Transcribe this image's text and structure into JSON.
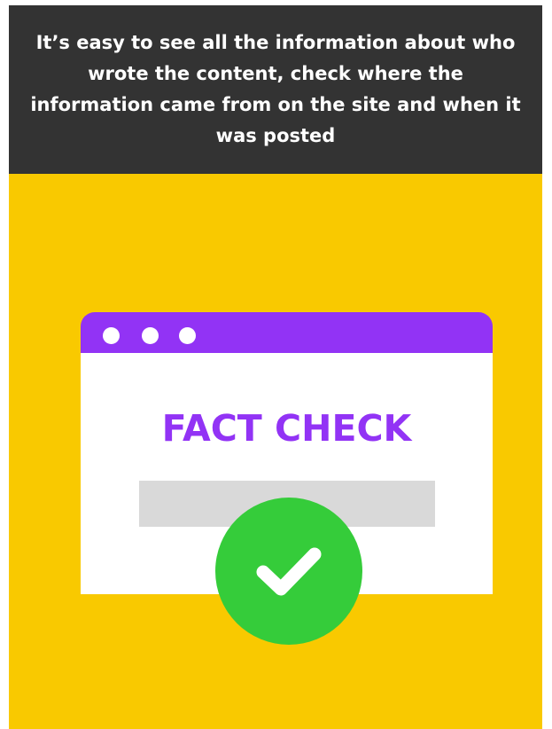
{
  "header": {
    "text": "It’s easy to see all the information about who wrote the content, check where the information came from on the site and when it was posted"
  },
  "browser": {
    "title": "FACT CHECK",
    "dots": [
      "dot",
      "dot",
      "dot"
    ]
  },
  "badge": {
    "icon": "checkmark-icon"
  },
  "colors": {
    "background": "#F9C900",
    "header": "#333333",
    "accent": "#9233F5",
    "success": "#35CC3A",
    "input": "#D9D9D9"
  }
}
